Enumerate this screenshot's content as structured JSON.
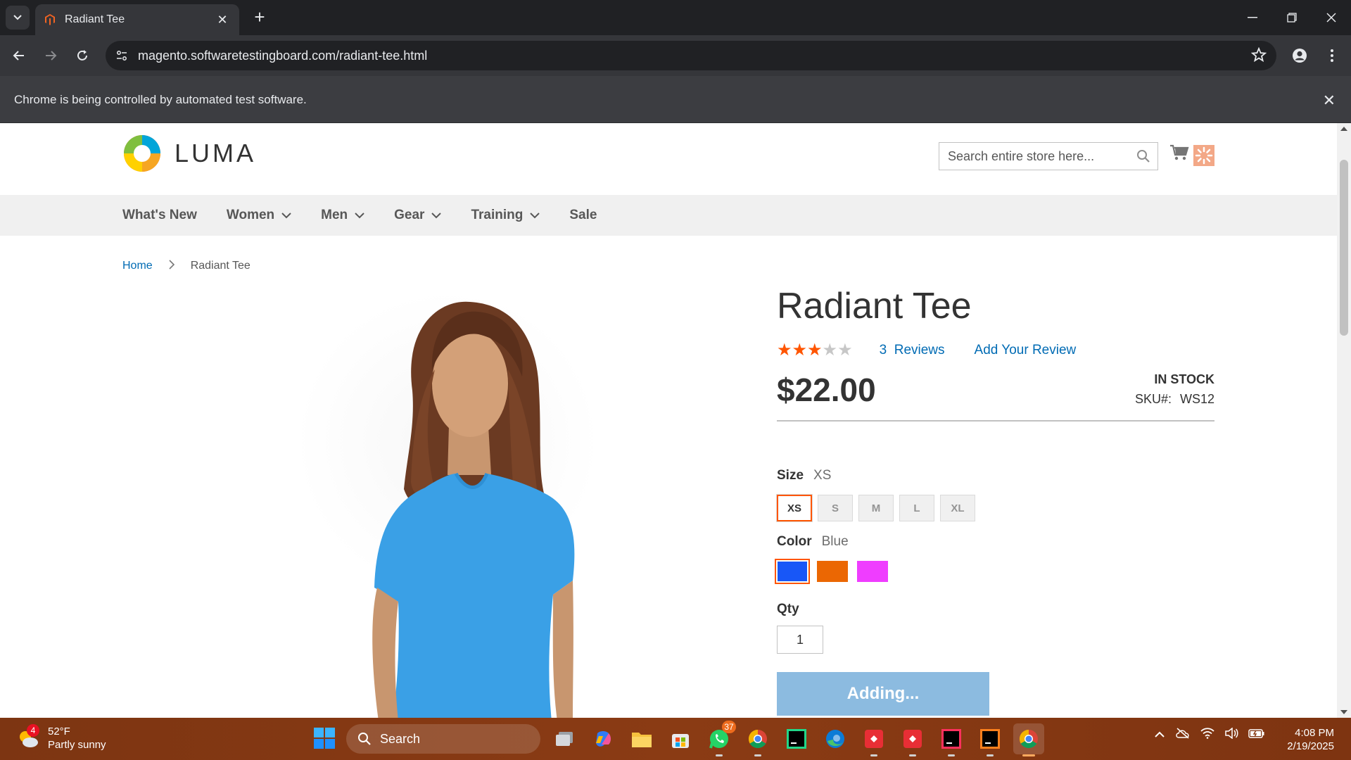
{
  "browser": {
    "tab_title": "Radiant Tee",
    "url_host": "magento.softwaretestingboard.com",
    "url_path": "/radiant-tee.html",
    "infobar_text": "Chrome is being controlled by automated test software."
  },
  "store": {
    "logo_text": "LUMA",
    "search_placeholder": "Search entire store here...",
    "nav": [
      {
        "label": "What's New",
        "has_dropdown": false
      },
      {
        "label": "Women",
        "has_dropdown": true
      },
      {
        "label": "Men",
        "has_dropdown": true
      },
      {
        "label": "Gear",
        "has_dropdown": true
      },
      {
        "label": "Training",
        "has_dropdown": true
      },
      {
        "label": "Sale",
        "has_dropdown": false
      }
    ],
    "breadcrumb": {
      "home": "Home",
      "separator": ">",
      "current": "Radiant Tee"
    }
  },
  "product": {
    "title": "Radiant Tee",
    "rating_stars": 3,
    "rating_max": 5,
    "reviews_count": "3",
    "reviews_label": "Reviews",
    "add_review": "Add Your Review",
    "price": "$22.00",
    "stock": "IN STOCK",
    "sku_label": "SKU#:",
    "sku": "WS12",
    "size_label": "Size",
    "size_selected": "XS",
    "sizes": [
      "XS",
      "S",
      "M",
      "L",
      "XL"
    ],
    "color_label": "Color",
    "color_selected": "Blue",
    "colors": [
      {
        "name": "Blue",
        "hex": "#1857f7",
        "selected": true
      },
      {
        "name": "Orange",
        "hex": "#eb6703",
        "selected": false
      },
      {
        "name": "Purple",
        "hex": "#ef3dff",
        "selected": false
      }
    ],
    "qty_label": "Qty",
    "qty": "1",
    "add_button": "Adding..."
  },
  "taskbar": {
    "weather_badge": "4",
    "weather_temp": "52°F",
    "weather_desc": "Partly sunny",
    "search_label": "Search",
    "whatsapp_badge": "37",
    "time": "4:08 PM",
    "date": "2/19/2025"
  },
  "colors": {
    "accent": "#ff5501",
    "link": "#006bb4",
    "nav_bg": "#f0f0f0",
    "button_disabled": "#8cbbe0"
  }
}
